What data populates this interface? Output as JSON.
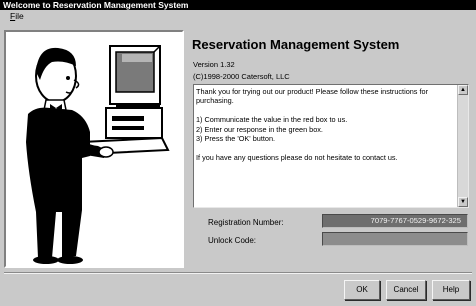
{
  "window": {
    "title": "Welcome to Reservation Management System"
  },
  "menu": {
    "file_label": "File",
    "file_accel": "F",
    "file_rest": "ile"
  },
  "app": {
    "name": "Reservation Management System",
    "version": "Version 1.32",
    "copyright": "(C)1998-2000 Catersoft, LLC"
  },
  "instructions": {
    "intro": "Thank you for trying out our product! Please follow these instructions for purchasing.",
    "steps": [
      "1) Communicate the value in the red box to us.",
      "2) Enter our response in the green box.",
      "3) Press the 'OK' button."
    ],
    "closing": "If you have any questions please do not hesitate to contact us."
  },
  "scrollbar": {
    "up_icon": "▲",
    "down_icon": "▼"
  },
  "registration": {
    "number_label": "Registration Number:",
    "number_value": "7079-7767-0529-9672-325",
    "unlock_label": "Unlock Code:",
    "unlock_value": ""
  },
  "buttons": {
    "ok": "OK",
    "cancel": "Cancel",
    "help": "Help"
  },
  "colors": {
    "registration_field": "#6e6e6e",
    "unlock_field": "#8c8c8c",
    "titlebar": "#000000"
  }
}
